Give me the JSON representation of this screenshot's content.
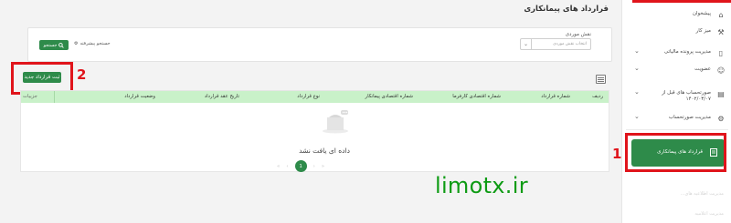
{
  "page": {
    "title": "قرارداد های پیمانکاری"
  },
  "filter": {
    "field_label": "نقش موردی",
    "select_placeholder": "انتخاب نقش موردی",
    "search_label": "جستجو",
    "advanced_label": "جستجو پیشرفته"
  },
  "toolbar": {
    "new_contract_label": "ثبت قرارداد جدید"
  },
  "table": {
    "columns": [
      "ردیف",
      "شماره قرارداد",
      "شماره اقتصادی کارفرما",
      "شماره اقتصادی پیمانکار",
      "نوع قرارداد",
      "تاریخ عقد قرارداد",
      "وضعیت قرارداد",
      "جزییات"
    ],
    "empty_text": "داده ای یافت نشد"
  },
  "pager": {
    "current_page": "1"
  },
  "annotations": {
    "one": "1",
    "two": "2"
  },
  "watermark": "limotx.ir",
  "sidebar": {
    "items": [
      {
        "label": "پیشخوان",
        "icon": "home-icon"
      },
      {
        "label": "میز کار",
        "icon": "briefcase-icon"
      },
      {
        "label": "مدیریت پرونده مالیاتی",
        "icon": "document-icon"
      },
      {
        "label": "عضویت",
        "icon": "user-icon"
      },
      {
        "label": "صورتحساب های قبل از ۱۴۰۲/۰۳/۰۷",
        "icon": "receipt-icon"
      },
      {
        "label": "مدیریت صورتحساب",
        "icon": "settings-icon"
      }
    ],
    "active_item": "قرارداد های پیمانکاری",
    "faded_items": [
      "مدیریت اطلاعیه های...",
      "مدیریت اعلامیه"
    ]
  },
  "colors": {
    "accent": "#2e8b4a",
    "header": "#c9f1c9",
    "annotation": "#e0141b",
    "watermark": "#0e9b14"
  }
}
